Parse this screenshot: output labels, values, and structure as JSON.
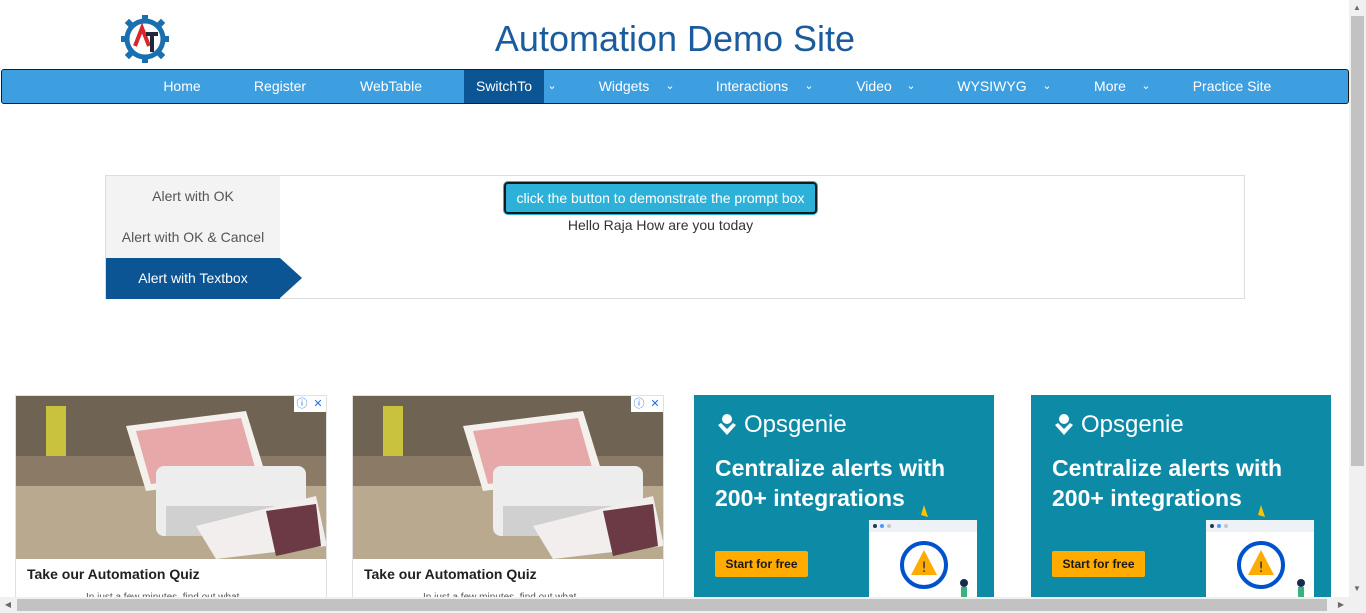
{
  "header": {
    "title": "Automation Demo Site",
    "logo_letters": "AT"
  },
  "nav": {
    "items": [
      {
        "label": "Home",
        "has_dropdown": false
      },
      {
        "label": "Register",
        "has_dropdown": false
      },
      {
        "label": "WebTable",
        "has_dropdown": false
      },
      {
        "label": "SwitchTo",
        "has_dropdown": true,
        "active": true
      },
      {
        "label": "Widgets",
        "has_dropdown": true
      },
      {
        "label": "Interactions",
        "has_dropdown": true
      },
      {
        "label": "Video",
        "has_dropdown": true
      },
      {
        "label": "WYSIWYG",
        "has_dropdown": true
      },
      {
        "label": "More",
        "has_dropdown": true
      },
      {
        "label": "Practice Site",
        "has_dropdown": false
      }
    ],
    "dropdown_icon": "chevron-down-icon"
  },
  "alerts": {
    "tabs": [
      {
        "label": "Alert with OK"
      },
      {
        "label": "Alert with OK & Cancel"
      },
      {
        "label": "Alert with Textbox",
        "active": true
      }
    ],
    "button_label": "click the button to demonstrate the prompt box",
    "result_text": "Hello Raja How are you today"
  },
  "ads": {
    "photo_ad": {
      "headline": "Take our Automation Quiz",
      "subtext": "In just a few minutes, find out what"
    },
    "opsgenie_ad": {
      "brand": "Opsgenie",
      "headline": "Centralize alerts with 200+ integrations",
      "cta": "Start for free"
    }
  },
  "colors": {
    "nav_bg": "#3e9fe0",
    "nav_active": "#0b5594",
    "title": "#1a5c9e",
    "button": "#2db1d8",
    "opsgenie_bg": "#0d8aa6",
    "cta": "#ffab00"
  }
}
